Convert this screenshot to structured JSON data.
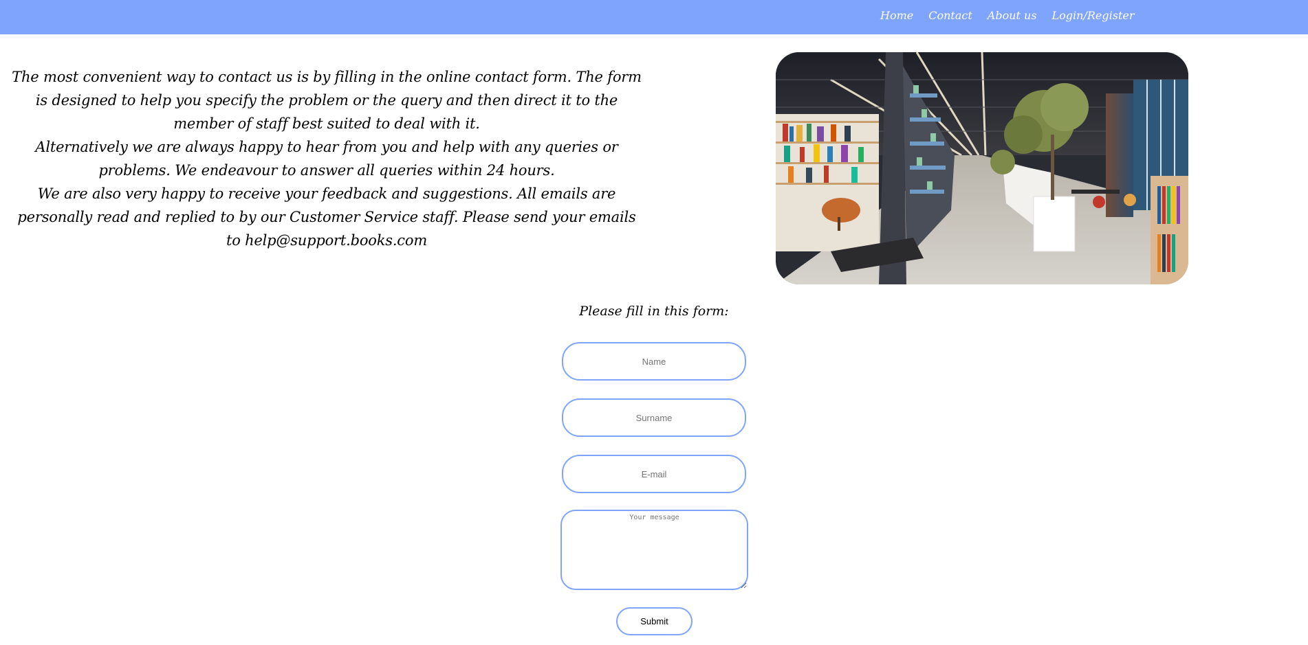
{
  "nav": {
    "items": [
      {
        "label": "Home"
      },
      {
        "label": "Contact"
      },
      {
        "label": "About us"
      },
      {
        "label": "Login/Register"
      }
    ]
  },
  "intro": {
    "paragraph_1": "The most convenient way to contact us is by filling in the online contact form. The form is designed to help you specify the problem or the query and then direct it to the member of staff best suited to deal with it.",
    "paragraph_2": "Alternatively we are always happy to hear from you and help with any queries or problems. We endeavour to answer all queries within 24 hours.",
    "paragraph_3": "We are also very happy to receive your feedback and suggestions. All emails are personally read and replied to by our Customer Service staff. Please send your emails to help@support.books.com"
  },
  "hero": {
    "image": "bookstore-interior-photo"
  },
  "form": {
    "title": "Please fill in this form:",
    "name_placeholder": "Name",
    "surname_placeholder": "Surname",
    "email_placeholder": "E-mail",
    "message_placeholder": "Your message",
    "submit_label": "Submit"
  },
  "colors": {
    "accent": "#7fa4fd",
    "nav_text": "#ffffff",
    "page_background": "#ffffff"
  }
}
